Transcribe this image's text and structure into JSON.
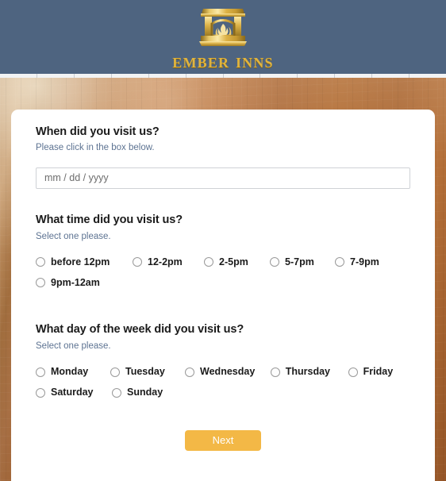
{
  "header": {
    "brand_name": "Ember Inns",
    "logo_icon": "fireplace-with-flames-icon",
    "background_color": "#4e6480",
    "logo_color": "#e0b43f"
  },
  "form": {
    "questions": [
      {
        "id": "visit-date",
        "title": "When did you visit us?",
        "subtitle": "Please click in the box below.",
        "input": {
          "type": "date",
          "placeholder": "mm / dd / yyyy",
          "value": ""
        }
      },
      {
        "id": "visit-time",
        "title": "What time did you visit us?",
        "subtitle": "Select one please.",
        "options": [
          "before 12pm",
          "12-2pm",
          "2-5pm",
          "5-7pm",
          "7-9pm",
          "9pm-12am"
        ],
        "selected": ""
      },
      {
        "id": "visit-day",
        "title": "What day of the week did you visit us?",
        "subtitle": "Select one please.",
        "options": [
          "Monday",
          "Tuesday",
          "Wednesday",
          "Thursday",
          "Friday",
          "Saturday",
          "Sunday"
        ],
        "selected": ""
      }
    ],
    "next_button": {
      "label": "Next",
      "color": "#f3b846"
    }
  }
}
